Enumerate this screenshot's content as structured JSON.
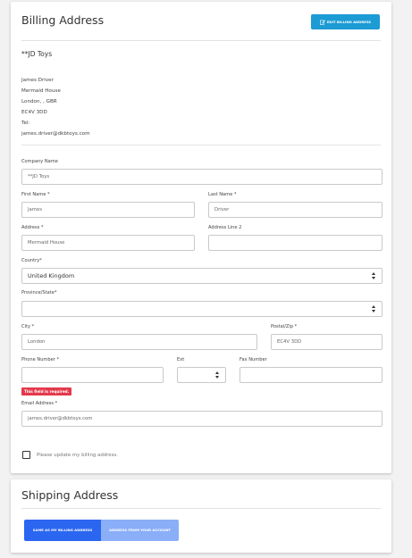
{
  "billing": {
    "title": "Billing Address",
    "edit_button_label": "EDIT BILLING ADDRESS",
    "company_heading": "**JD Toys",
    "address_lines": [
      "James Driver",
      "Mermaid House",
      "London, , GBR",
      "EC4V 3DD",
      "Tel:",
      "james.driver@dkbtoys.com"
    ]
  },
  "form": {
    "company_name": {
      "label": "Company Name",
      "value": "**JD Toys"
    },
    "first_name": {
      "label": "First Name *",
      "value": "James"
    },
    "last_name": {
      "label": "Last Name *",
      "value": "Driver"
    },
    "address": {
      "label": "Address *",
      "value": "Mermaid House"
    },
    "address_line2": {
      "label": "Address Line 2",
      "value": ""
    },
    "country": {
      "label": "Country*",
      "value": "United Kingdom"
    },
    "province": {
      "label": "Province/State*",
      "value": ""
    },
    "city": {
      "label": "City *",
      "value": "London"
    },
    "postal": {
      "label": "Postal/Zip *",
      "value": "EC4V 3DD"
    },
    "phone": {
      "label": "Phone Number *",
      "value": "",
      "error": "This field is required."
    },
    "ext": {
      "label": "Ext",
      "value": ""
    },
    "fax": {
      "label": "Fax Number",
      "value": ""
    },
    "email": {
      "label": "Email Address *",
      "value": "james.driver@dkbtoys.com"
    },
    "update_checkbox_label": "Please update my billing address."
  },
  "shipping": {
    "title": "Shipping Address",
    "same_as_billing_label": "SAME AS MY BILLING ADDRESS",
    "from_account_label": "ADDRESS FROM YOUR ACCOUNT"
  },
  "colors": {
    "accent": "#1c9bd4",
    "primary_button": "#2a66f0",
    "secondary_button": "#8aaef7",
    "error": "#e4394c"
  }
}
